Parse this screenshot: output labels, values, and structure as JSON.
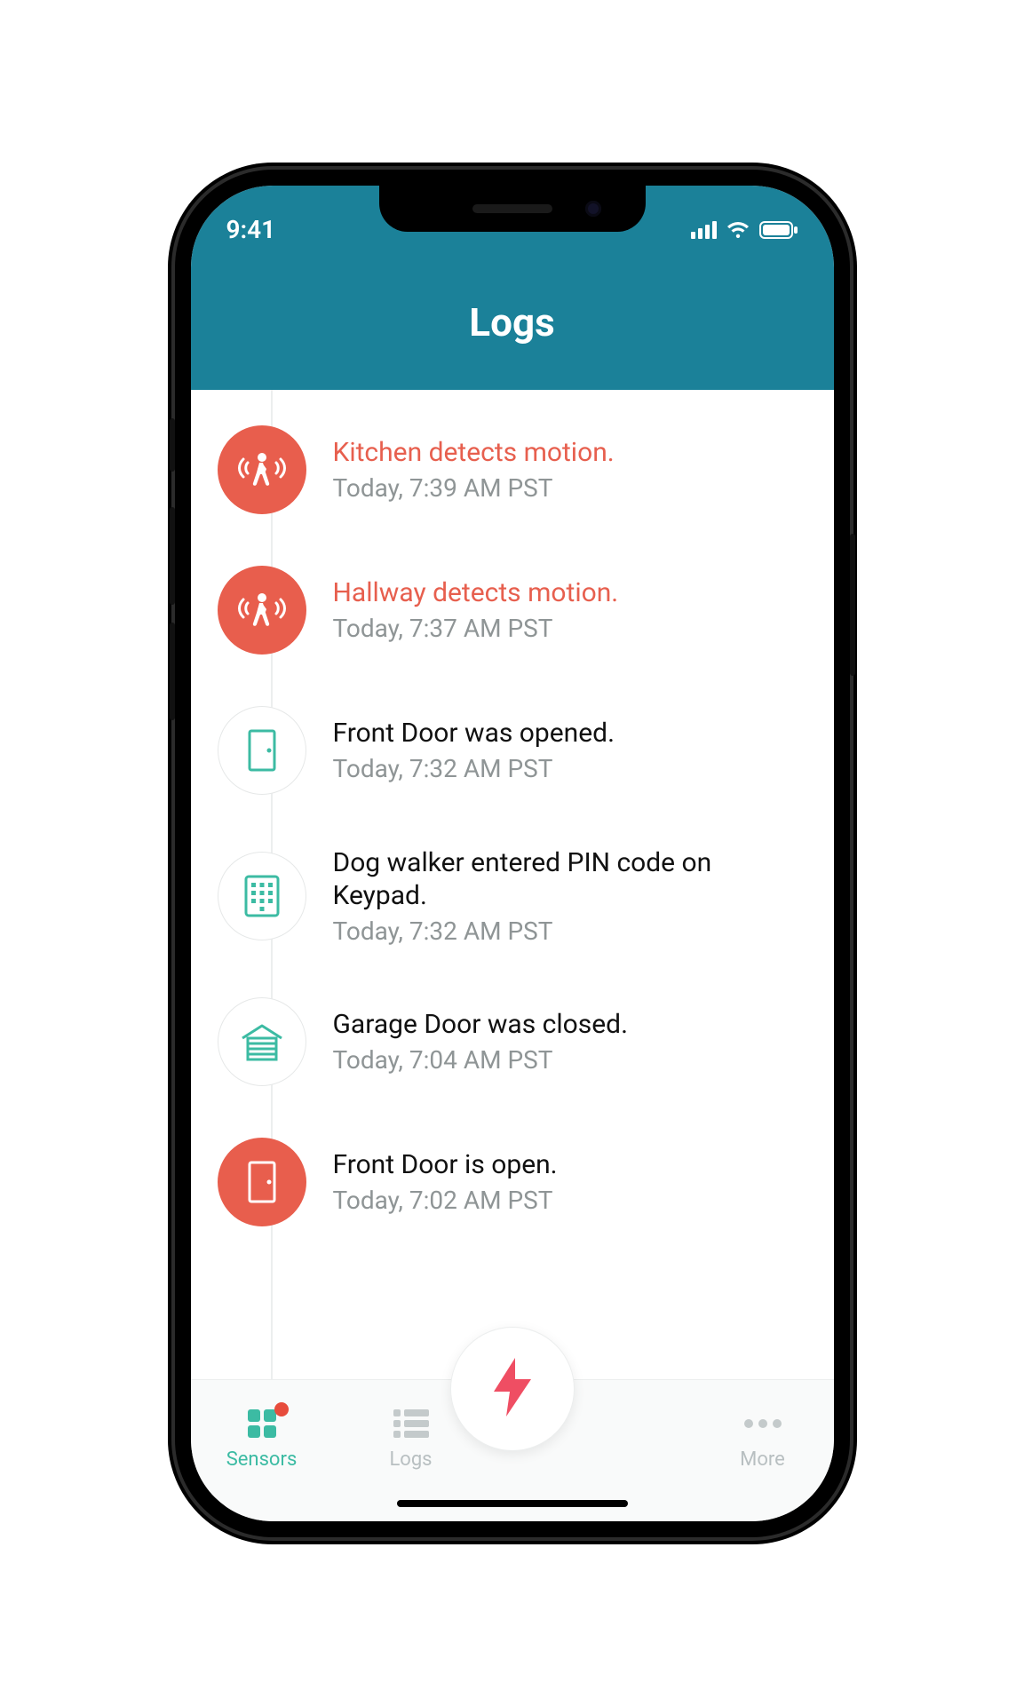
{
  "statusbar": {
    "time": "9:41"
  },
  "header": {
    "title": "Logs"
  },
  "colors": {
    "accent_teal": "#1b8199",
    "alert_red": "#e85e4d",
    "green": "#3cbba3"
  },
  "logs": [
    {
      "icon": "motion",
      "alert": true,
      "title": "Kitchen detects motion.",
      "time": "Today, 7:39 AM PST"
    },
    {
      "icon": "motion",
      "alert": true,
      "title": "Hallway detects motion.",
      "time": "Today, 7:37 AM PST"
    },
    {
      "icon": "door",
      "alert": false,
      "title": "Front Door was opened.",
      "time": "Today, 7:32 AM PST"
    },
    {
      "icon": "keypad",
      "alert": false,
      "title": "Dog walker entered PIN code on Keypad.",
      "time": "Today, 7:32 AM PST"
    },
    {
      "icon": "garage",
      "alert": false,
      "title": "Garage Door was closed.",
      "time": "Today, 7:04 AM PST"
    },
    {
      "icon": "door",
      "alert": true,
      "title": "Front Door is open.",
      "time": "Today, 7:02 AM PST"
    }
  ],
  "tabs": {
    "sensors": "Sensors",
    "logs": "Logs",
    "more": "More"
  }
}
